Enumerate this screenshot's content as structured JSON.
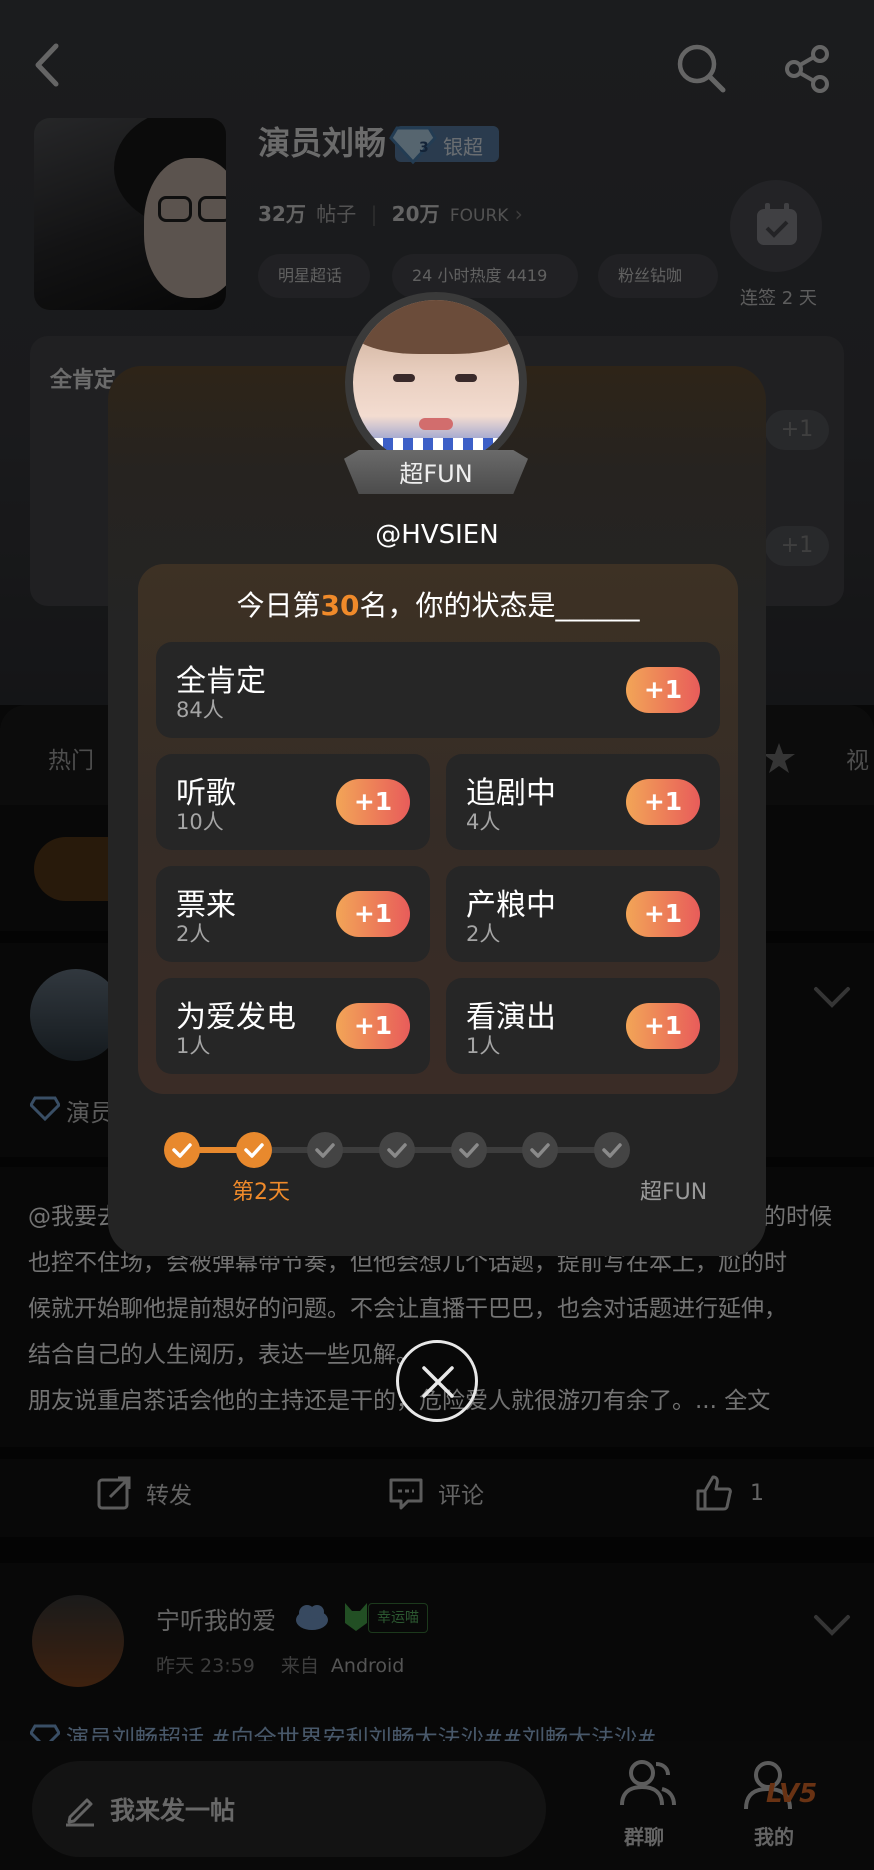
{
  "header": {
    "name": "演员刘畅",
    "badge_level": "3",
    "badge_label": "银超",
    "posts_count": "32万",
    "posts_label": "帖子",
    "fans_count": "20万",
    "fans_label": "FOURK",
    "tags": [
      "明星超话",
      "24 小时热度 4419",
      "粉丝钻咖"
    ],
    "checkin_label": "连签 2 天"
  },
  "bg_card": {
    "title": "全肯定",
    "plus_label": "+1"
  },
  "tabs": [
    "热门",
    "视"
  ],
  "bg_post": {
    "user_prefix": "演员",
    "lines": [
      "@我要去",
      "也控不住场，会被弹幕带节奏，但他会想几个话题，提前写在本上，尬的时",
      "候就开始聊他提前想好的问题。不会让直播干巴巴，也会对话题进行延伸，",
      "结合自己的人生阅历，表达一些见解。",
      "朋友说重启茶话会他的主持还是干的，危险爱人就很游刃有余了。... 全文"
    ],
    "line0_right": "播的时候",
    "repost_label": "转发",
    "comment_label": "评论",
    "like_label": "1"
  },
  "post2": {
    "username": "宁听我的爱",
    "lucky_tag": "幸运喵",
    "time": "昨天 23:59",
    "source_label": "来自",
    "source": "Android",
    "content": "演员刘畅超话 #向全世界安利刘畅大法沙##刘畅大法沙#"
  },
  "bottom_bar": {
    "compose_label": "我来发一帖",
    "group_label": "群聊",
    "level_label": "LV5",
    "me_label": "我的"
  },
  "dialog": {
    "frame_label": "超FUN",
    "handle": "@HVSIEN",
    "question_prefix": "今日第",
    "rank": "30",
    "question_suffix": "名，你的状态是______",
    "plus_label": "+1",
    "options": [
      {
        "name": "全肯定",
        "count": "84人"
      },
      {
        "name": "听歌",
        "count": "10人"
      },
      {
        "name": "追剧中",
        "count": "4人"
      },
      {
        "name": "票来",
        "count": "2人"
      },
      {
        "name": "产粮中",
        "count": "2人"
      },
      {
        "name": "为爱发电",
        "count": "1人"
      },
      {
        "name": "看演出",
        "count": "1人"
      }
    ],
    "progress_current_label": "第2天",
    "progress_end_label": "超FUN",
    "progress_done_steps": 2,
    "progress_total_steps": 7
  }
}
